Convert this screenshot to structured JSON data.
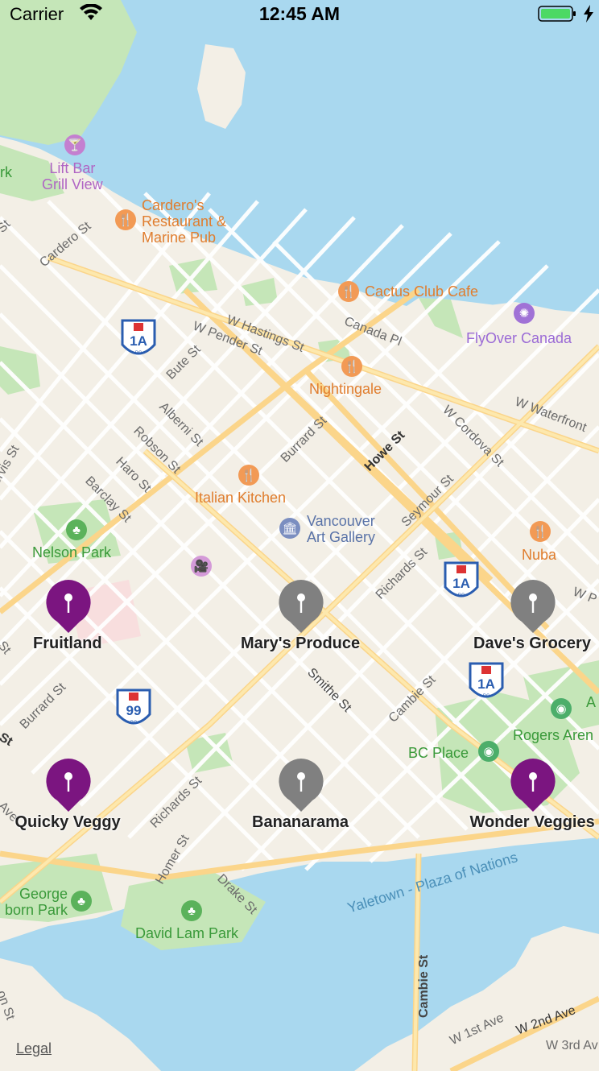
{
  "status_bar": {
    "carrier": "Carrier",
    "time": "12:45 AM"
  },
  "colors": {
    "water": "#a9d8ef",
    "land": "#f3efe6",
    "park": "#c5e6b8",
    "road": "#fde8ad",
    "pin_selected": "#7b1580",
    "pin_default": "#808080"
  },
  "pois": {
    "lift_bar": "Lift Bar\nGrill View",
    "cardero": "Cardero's\nRestaurant &\nMarine Pub",
    "cactus": "Cactus Club Cafe",
    "flyover": "FlyOver Canada",
    "nightingale": "Nightingale",
    "italian": "Italian Kitchen",
    "gallery": "Vancouver\nArt Gallery",
    "nuba": "Nuba",
    "nelson": "Nelson Park",
    "bcplace": "BC Place",
    "rogers": "Rogers Aren",
    "george": "George\nborn Park",
    "davidlam": "David Lam Park",
    "park_left": "rk",
    "yaletown": "Yaletown - Plaza of Nations",
    "a_right": "A"
  },
  "streets": {
    "cardero": "Cardero St",
    "hastings": "W Hastings St",
    "pender": "W Pender St",
    "canada": "Canada Pl",
    "cordova": "W Cordova St",
    "waterfront": "W Waterfront",
    "bute": "Bute St",
    "alberni": "Alberni St",
    "robson": "Robson St",
    "haro": "Haro St",
    "barclay": "Barclay St",
    "burrard": "Burrard St",
    "burrard2": "Burrard St",
    "howe": "Howe St",
    "seymour": "Seymour St",
    "richards": "Richards St",
    "richards2": "Richards St",
    "smithe": "Smithe St",
    "cambie": "Cambie St",
    "cambie2": "Cambie St",
    "homer": "Homer St",
    "drake": "Drake St",
    "ervis": "ervis St",
    "w_right": "W P",
    "w1st": "W 1st Ave",
    "w2nd": "W 2nd Ave",
    "w3rd": "W 3rd Av",
    "st_left1": "St",
    "st_left2": "St",
    "st_left3": "St",
    "ave_left": "Ave",
    "on_st": "on St"
  },
  "highways": [
    "1A",
    "1A",
    "1A",
    "99"
  ],
  "pins": [
    {
      "label": "Fruitland",
      "selected": true
    },
    {
      "label": "Mary's Produce",
      "selected": false
    },
    {
      "label": "Dave's Grocery",
      "selected": false
    },
    {
      "label": "Quicky Veggy",
      "selected": true
    },
    {
      "label": "Bananarama",
      "selected": false
    },
    {
      "label": "Wonder Veggies",
      "selected": true
    }
  ],
  "legal": "Legal"
}
